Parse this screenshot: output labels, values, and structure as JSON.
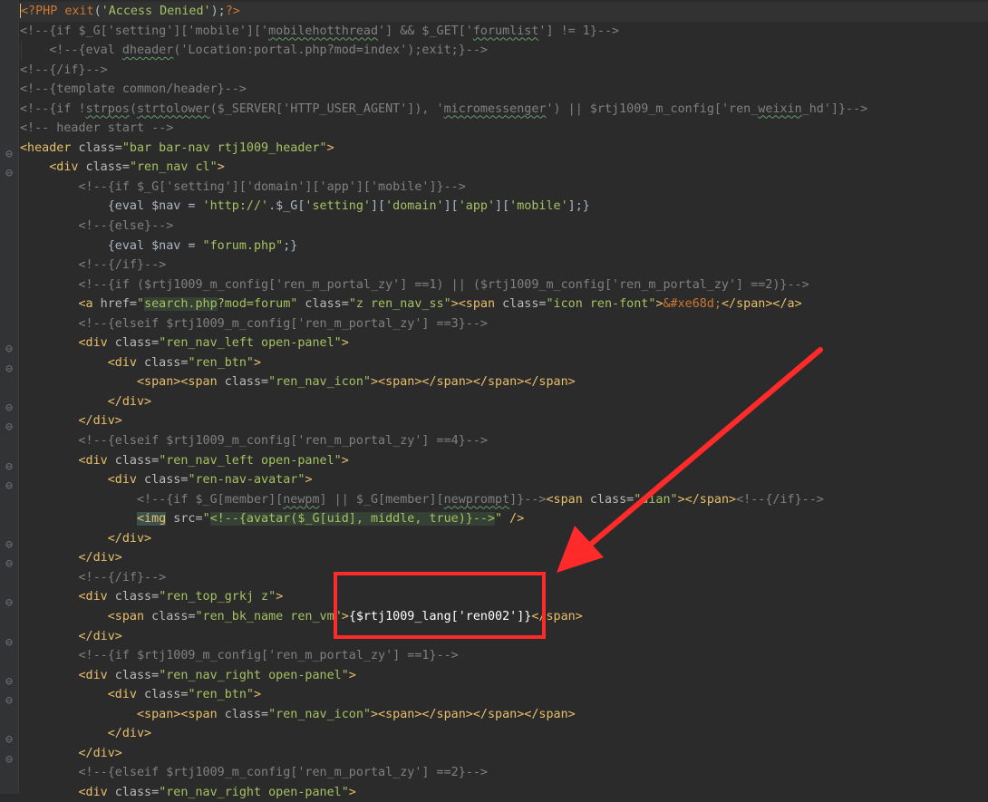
{
  "editor": {
    "lines": [
      "<?PHP exit('Access Denied');?>",
      "<!--{if $_G['setting']['mobile']['mobilehotthread'] && $_GET['forumlist'] != 1}-->",
      "    <!--{eval dheader('Location:portal.php?mod=index');exit;}-->",
      "<!--{/if}-->",
      "<!--{template common/header}-->",
      "<!--{if !strpos(strtolower($_SERVER['HTTP_USER_AGENT']), 'micromessenger') || $rtj1009_m_config['ren_weixin_hd']}-->",
      "<!-- header start -->",
      "<header class=\"bar bar-nav rtj1009_header\">",
      "    <div class=\"ren_nav cl\">",
      "        <!--{if $_G['setting']['domain']['app']['mobile']}-->",
      "            {eval $nav = 'http://'.$_G['setting']['domain']['app']['mobile'];}",
      "        <!--{else}-->",
      "            {eval $nav = \"forum.php\";}",
      "        <!--{/if}-->",
      "        <!--{if ($rtj1009_m_config['ren_m_portal_zy'] ==1) || ($rtj1009_m_config['ren_m_portal_zy'] ==2)}-->",
      "        <a href=\"search.php?mod=forum\" class=\"z ren_nav_ss\"><span class=\"icon ren-font\">&#xe68d;</span></a>",
      "        <!--{elseif $rtj1009_m_config['ren_m_portal_zy'] ==3}-->",
      "        <div class=\"ren_nav_left open-panel\">",
      "            <div class=\"ren_btn\">",
      "                <span><span class=\"ren_nav_icon\"><span></span></span></span>",
      "            </div>",
      "        </div>",
      "        <!--{elseif $rtj1009_m_config['ren_m_portal_zy'] ==4}-->",
      "        <div class=\"ren_nav_left open-panel\">",
      "            <div class=\"ren-nav-avatar\">",
      "                <!--{if $_G[member][newpm] || $_G[member][newprompt]}--><span class=\"dian\"></span><!--{/if}-->",
      "                <img src=\"<!--{avatar($_G[uid], middle, true)}-->\" />",
      "            </div>",
      "        </div>",
      "        <!--{/if}-->",
      "        <div class=\"ren_top_grkj z\">",
      "            <span class=\"ren_bk_name ren_vm\">{$rtj1009_lang['ren002']}</span>",
      "        </div>",
      "        <!--{if $rtj1009_m_config['ren_m_portal_zy'] ==1}-->",
      "        <div class=\"ren_nav_right open-panel\">",
      "            <div class=\"ren_btn\">",
      "                <span><span class=\"ren_nav_icon\"><span></span></span></span>",
      "            </div>",
      "        </div>",
      "        <!--{elseif $rtj1009_m_config['ren_m_portal_zy'] ==2}-->",
      "        <div class=\"ren_nav_right open-panel\">"
    ]
  },
  "annotation": {
    "highlighted_text": "{$rtj1009_lang['ren002']}",
    "color": "#ff2a2a"
  },
  "colors": {
    "background": "#2b2b2b",
    "comment": "#808080",
    "tag": "#e8bf6a",
    "string": "#a5c261",
    "keyword": "#cc7832",
    "variable": "#9876aa"
  }
}
